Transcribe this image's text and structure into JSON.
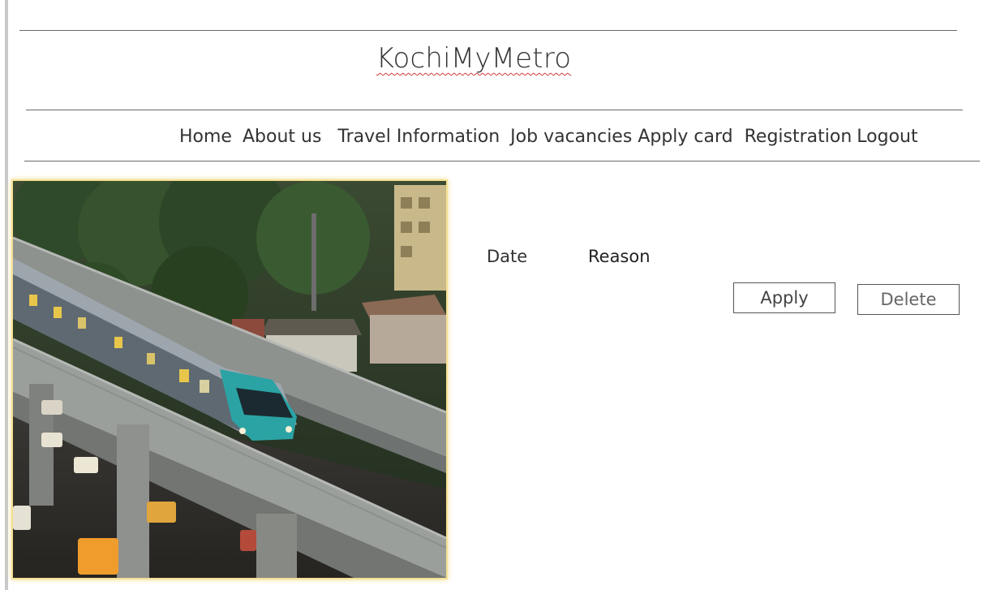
{
  "header": {
    "title": "KochiMyMetro"
  },
  "nav": {
    "items": [
      "Home",
      "About us",
      "Travel Information",
      "Job vacancies",
      "Apply card",
      "Registration",
      "Logout"
    ]
  },
  "form": {
    "date_label": "Date",
    "reason_label": "Reason",
    "apply_label": "Apply",
    "delete_label": "Delete"
  },
  "colors": {
    "photo_border": "#f4df92",
    "title_underline": "#d23b3b"
  }
}
